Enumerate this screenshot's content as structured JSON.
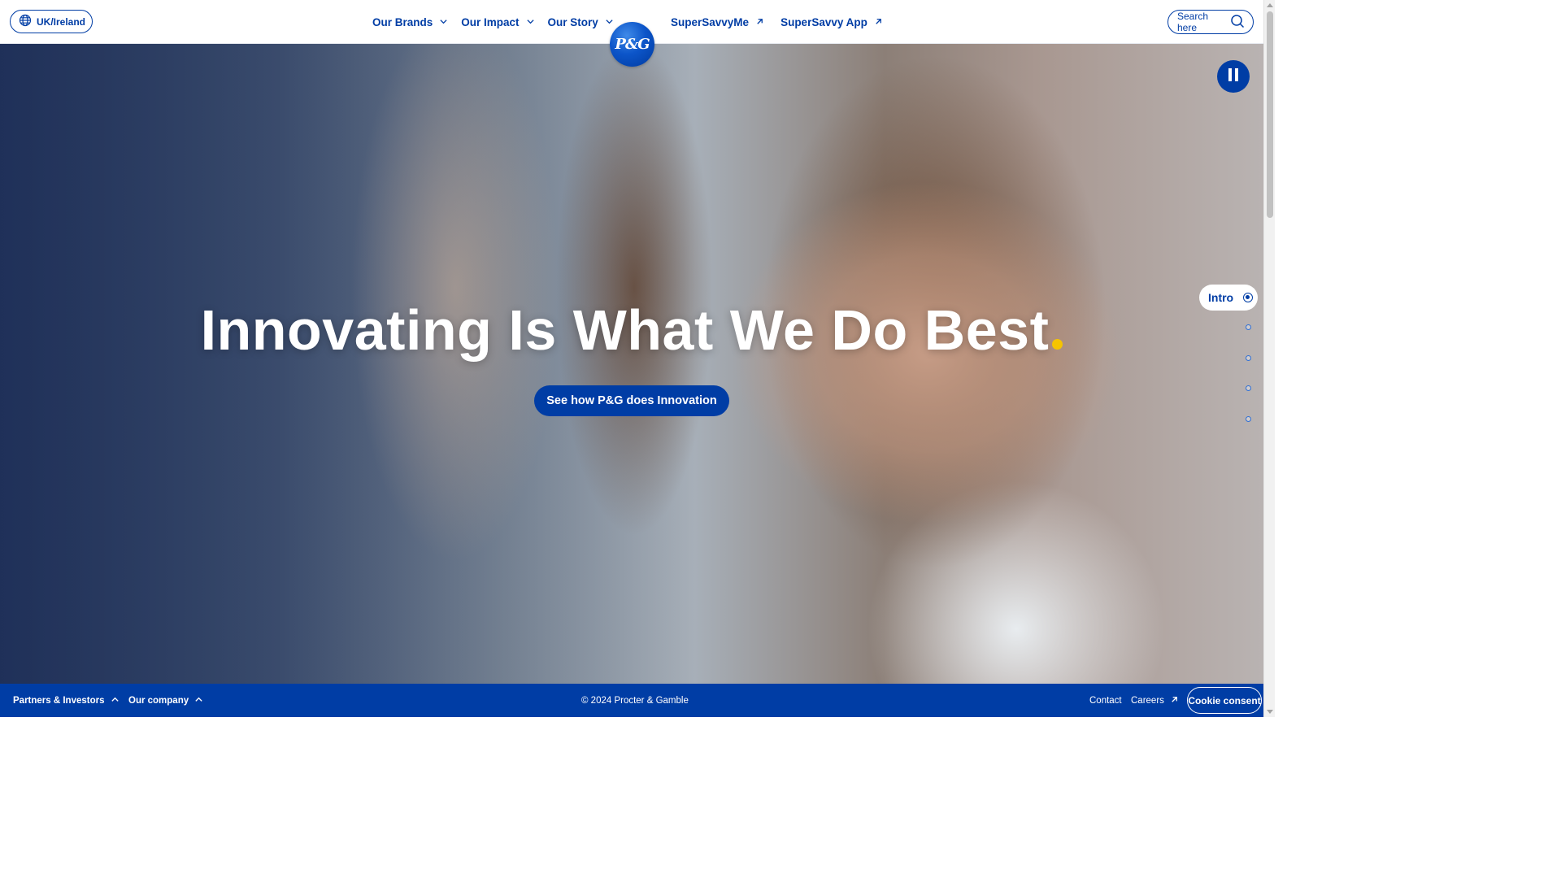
{
  "header": {
    "region_label": "UK/Ireland",
    "nav_left": [
      {
        "label": "Our Brands",
        "icon": "chevron-down-icon"
      },
      {
        "label": "Our Impact",
        "icon": "chevron-down-icon"
      },
      {
        "label": "Our Story",
        "icon": "chevron-down-icon"
      }
    ],
    "logo_text": "P&G",
    "nav_right": [
      {
        "label": "SuperSavvyMe",
        "icon": "external-arrow-icon"
      },
      {
        "label": "SuperSavvy App",
        "icon": "external-arrow-icon"
      }
    ],
    "search_label": "Search here"
  },
  "hero": {
    "title": "Innovating Is What We Do Best",
    "cta_label": "See how P&G does Innovation",
    "active_section": "Intro",
    "section_count": 5
  },
  "footer": {
    "partners_label": "Partners & Investors",
    "company_label": "Our company",
    "copyright": "© 2024 Procter & Gamble",
    "contact_label": "Contact",
    "careers_label": "Careers",
    "cookie_label": "Cookie consent"
  },
  "colors": {
    "brand_blue": "#003da5",
    "accent_yellow": "#f5c400"
  }
}
